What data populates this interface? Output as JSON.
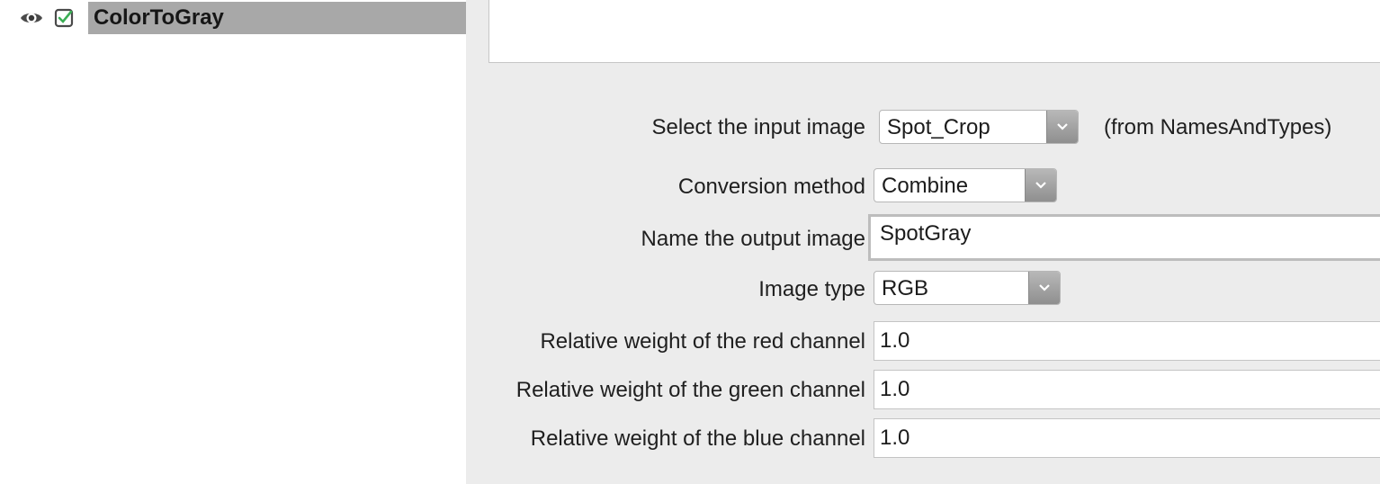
{
  "pipeline": {
    "module_name": "ColorToGray",
    "icons": {
      "visibility": "eye-icon",
      "enabled": "check-icon"
    }
  },
  "settings": {
    "input_image": {
      "label": "Select the input image",
      "value": "Spot_Crop",
      "hint": "(from NamesAndTypes)"
    },
    "conversion_method": {
      "label": "Conversion method",
      "value": "Combine"
    },
    "output_image": {
      "label": "Name the output image",
      "value": "SpotGray"
    },
    "image_type": {
      "label": "Image type",
      "value": "RGB"
    },
    "red_weight": {
      "label": "Relative weight of the red channel",
      "value": "1.0"
    },
    "green_weight": {
      "label": "Relative weight of the green channel",
      "value": "1.0"
    },
    "blue_weight": {
      "label": "Relative weight of the blue channel",
      "value": "1.0"
    }
  }
}
